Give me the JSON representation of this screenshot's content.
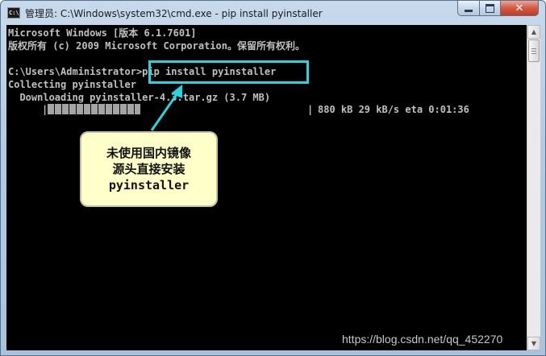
{
  "window": {
    "icon_text": "C:\\.",
    "title": "管理员: C:\\Windows\\system32\\cmd.exe - pip  install pyinstaller",
    "close_glyph": "✕"
  },
  "console": {
    "lines": [
      "Microsoft Windows [版本 6.1.7601]",
      "版权所有 (c) 2009 Microsoft Corporation。保留所有权利。",
      "",
      "C:\\Users\\Administrator>pip install pyinstaller",
      "Collecting pyinstaller",
      "  Downloading pyinstaller-4.3.tar.gz (3.7 MB)"
    ],
    "progress": {
      "fraction": 0.36,
      "start_char": "|",
      "end_char": "|",
      "stats": "880 kB 29 kB/s eta 0:01:36"
    }
  },
  "annotation": {
    "callout_lines": [
      "未使用国内镜像",
      "源头直接安装",
      "pyinstaller"
    ],
    "highlight_color": "#25d5e0",
    "callout_color": "#ffffc9"
  },
  "scrollbar": {
    "up": "▲",
    "down": "▼"
  },
  "watermark": "https://blog.csdn.net/qq_452270"
}
